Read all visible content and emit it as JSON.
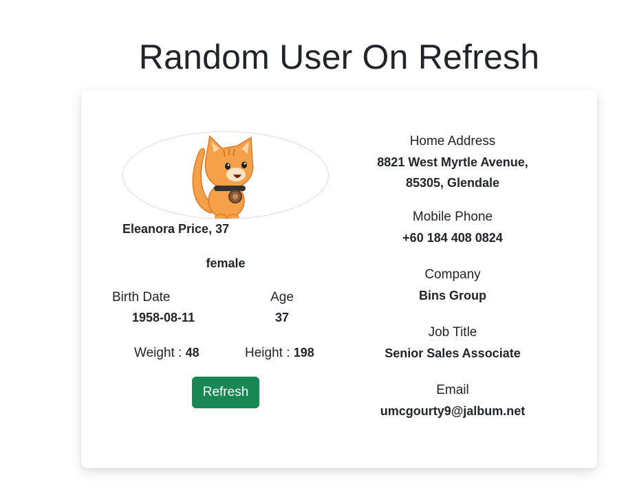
{
  "header": {
    "title": "Random User On Refresh"
  },
  "profile": {
    "avatar_icon": "cat-avatar-icon",
    "name_line": "Eleanora Price, 37",
    "gender": "female",
    "birth_date_label": "Birth Date",
    "birth_date": "1958-08-11",
    "age_label": "Age",
    "age": "37",
    "weight_label": "Weight : ",
    "weight": "48",
    "height_label": "Height : ",
    "height": "198",
    "refresh_label": "Refresh"
  },
  "details": {
    "address_label": "Home Address",
    "address_line1": "8821 West Myrtle Avenue,",
    "address_line2": "85305, Glendale",
    "phone_label": "Mobile Phone",
    "phone": "+60 184 408 0824",
    "company_label": "Company",
    "company": "Bins Group",
    "job_label": "Job Title",
    "job": "Senior Sales Associate",
    "email_label": "Email",
    "email": "umcgourty9@jalbum.net"
  },
  "colors": {
    "button_bg": "#198754",
    "text": "#212529",
    "cat": "#f7a04a"
  }
}
